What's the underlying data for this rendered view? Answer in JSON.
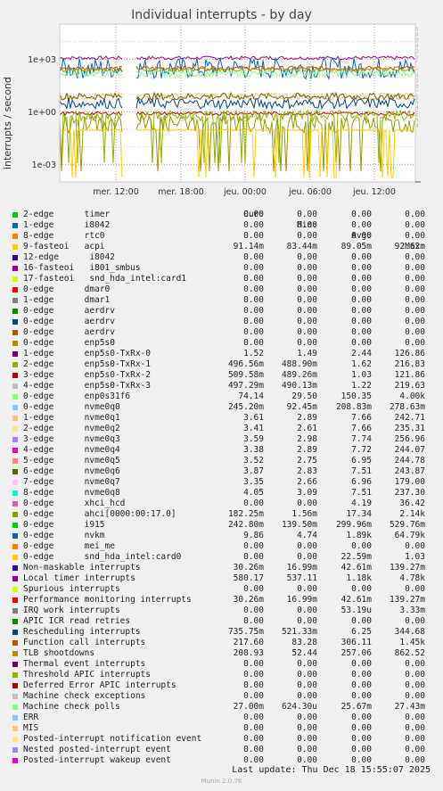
{
  "chart_data": {
    "type": "line",
    "title": "Individual interrupts - by day",
    "ylabel": "interrupts / second",
    "yscale": "log",
    "ylim": [
      0.0001,
      100000
    ],
    "yticks": [
      "1e+03",
      "1e+00",
      "1e-03"
    ],
    "xticks": [
      "mer. 12:00",
      "mer. 18:00",
      "jeu. 00:00",
      "jeu. 06:00",
      "jeu. 12:00"
    ],
    "grid": true,
    "columns": [
      "Cur:",
      "Min:",
      "Avg:",
      "Max:"
    ],
    "series": [
      {
        "name": "2-edge      timer",
        "color": "#00cc00",
        "cur": "0.00",
        "min": "0.00",
        "avg": "0.00",
        "max": "0.00"
      },
      {
        "name": "1-edge      i8042",
        "color": "#0066b3",
        "cur": "0.00",
        "min": "0.00",
        "avg": "0.00",
        "max": "0.00"
      },
      {
        "name": "8-edge      rtc0",
        "color": "#ff8000",
        "cur": "0.00",
        "min": "0.00",
        "avg": "0.00",
        "max": "0.00"
      },
      {
        "name": "9-fasteoi   acpi",
        "color": "#ffcc00",
        "cur": "91.14m",
        "min": "83.44m",
        "avg": "89.05m",
        "max": "92.62m"
      },
      {
        "name": "12-edge      i8042",
        "color": "#330099",
        "cur": "0.00",
        "min": "0.00",
        "avg": "0.00",
        "max": "0.00"
      },
      {
        "name": "16-fasteoi   i801_smbus",
        "color": "#990099",
        "cur": "0.00",
        "min": "0.00",
        "avg": "0.00",
        "max": "0.00"
      },
      {
        "name": "17-fasteoi   snd_hda_intel:card1",
        "color": "#ccff00",
        "cur": "0.00",
        "min": "0.00",
        "avg": "0.00",
        "max": "0.00"
      },
      {
        "name": "0-edge      dmar0",
        "color": "#ff0000",
        "cur": "0.00",
        "min": "0.00",
        "avg": "0.00",
        "max": "0.00"
      },
      {
        "name": "1-edge      dmar1",
        "color": "#808080",
        "cur": "0.00",
        "min": "0.00",
        "avg": "0.00",
        "max": "0.00"
      },
      {
        "name": "0-edge      aerdrv",
        "color": "#008f00",
        "cur": "0.00",
        "min": "0.00",
        "avg": "0.00",
        "max": "0.00"
      },
      {
        "name": "0-edge      aerdrv",
        "color": "#00487d",
        "cur": "0.00",
        "min": "0.00",
        "avg": "0.00",
        "max": "0.00"
      },
      {
        "name": "0-edge      aerdrv",
        "color": "#b35a00",
        "cur": "0.00",
        "min": "0.00",
        "avg": "0.00",
        "max": "0.00"
      },
      {
        "name": "0-edge      enp5s0",
        "color": "#b38f00",
        "cur": "0.00",
        "min": "0.00",
        "avg": "0.00",
        "max": "0.00"
      },
      {
        "name": "1-edge      enp5s0-TxRx-0",
        "color": "#6b006b",
        "cur": "1.52",
        "min": "1.49",
        "avg": "2.44",
        "max": "126.86"
      },
      {
        "name": "2-edge      enp5s0-TxRx-1",
        "color": "#8fb300",
        "cur": "496.56m",
        "min": "488.90m",
        "avg": "1.62",
        "max": "216.83"
      },
      {
        "name": "3-edge      enp5s0-TxRx-2",
        "color": "#b30000",
        "cur": "509.58m",
        "min": "489.26m",
        "avg": "1.03",
        "max": "121.86"
      },
      {
        "name": "4-edge      enp5s0-TxRx-3",
        "color": "#bebebe",
        "cur": "497.29m",
        "min": "490.13m",
        "avg": "1.22",
        "max": "219.63"
      },
      {
        "name": "0-edge      enp0s31f6",
        "color": "#80ff80",
        "cur": "74.14",
        "min": "29.50",
        "avg": "150.35",
        "max": "4.00k"
      },
      {
        "name": "0-edge      nvme0q0",
        "color": "#80c9ff",
        "cur": "245.20m",
        "min": "92.45m",
        "avg": "208.83m",
        "max": "278.63m"
      },
      {
        "name": "1-edge      nvme0q1",
        "color": "#ffc080",
        "cur": "3.61",
        "min": "2.89",
        "avg": "7.66",
        "max": "242.71"
      },
      {
        "name": "2-edge      nvme0q2",
        "color": "#ffe680",
        "cur": "3.41",
        "min": "2.61",
        "avg": "7.66",
        "max": "235.31"
      },
      {
        "name": "3-edge      nvme0q3",
        "color": "#aa80ff",
        "cur": "3.59",
        "min": "2.98",
        "avg": "7.74",
        "max": "256.96"
      },
      {
        "name": "4-edge      nvme0q4",
        "color": "#ee00cc",
        "cur": "3.38",
        "min": "2.89",
        "avg": "7.72",
        "max": "244.07"
      },
      {
        "name": "5-edge      nvme0q5",
        "color": "#ff8080",
        "cur": "3.52",
        "min": "2.75",
        "avg": "6.95",
        "max": "244.78"
      },
      {
        "name": "6-edge      nvme0q6",
        "color": "#666600",
        "cur": "3.87",
        "min": "2.83",
        "avg": "7.51",
        "max": "243.87"
      },
      {
        "name": "7-edge      nvme0q7",
        "color": "#ffbfff",
        "cur": "3.35",
        "min": "2.66",
        "avg": "6.96",
        "max": "179.00"
      },
      {
        "name": "8-edge      nvme0q8",
        "color": "#00ffcc",
        "cur": "4.05",
        "min": "3.09",
        "avg": "7.51",
        "max": "237.30"
      },
      {
        "name": "0-edge      xhci_hcd",
        "color": "#cc6699",
        "cur": "0.00",
        "min": "0.00",
        "avg": "4.19",
        "max": "36.42"
      },
      {
        "name": "0-edge      ahci[0000:00:17.0]",
        "color": "#999900",
        "cur": "182.25m",
        "min": "1.56m",
        "avg": "17.34",
        "max": "2.14k"
      },
      {
        "name": "0-edge      i915",
        "color": "#00cc00",
        "cur": "242.80m",
        "min": "139.50m",
        "avg": "299.96m",
        "max": "529.76m"
      },
      {
        "name": "0-edge      nvkm",
        "color": "#0066b3",
        "cur": "9.86",
        "min": "4.74",
        "avg": "1.89k",
        "max": "64.79k"
      },
      {
        "name": "0-edge      mei_me",
        "color": "#ff8000",
        "cur": "0.00",
        "min": "0.00",
        "avg": "0.00",
        "max": "0.00"
      },
      {
        "name": "0-edge      snd_hda_intel:card0",
        "color": "#ffcc00",
        "cur": "0.00",
        "min": "0.00",
        "avg": "22.59m",
        "max": "1.03"
      },
      {
        "name": "Non-maskable interrupts",
        "color": "#330099",
        "cur": "30.26m",
        "min": "16.99m",
        "avg": "42.61m",
        "max": "139.27m"
      },
      {
        "name": "Local timer interrupts",
        "color": "#990099",
        "cur": "580.17",
        "min": "537.11",
        "avg": "1.18k",
        "max": "4.78k"
      },
      {
        "name": "Spurious interrupts",
        "color": "#ccff00",
        "cur": "0.00",
        "min": "0.00",
        "avg": "0.00",
        "max": "0.00"
      },
      {
        "name": "Performance monitoring interrupts",
        "color": "#ff0000",
        "cur": "30.26m",
        "min": "16.99m",
        "avg": "42.61m",
        "max": "139.27m"
      },
      {
        "name": "IRQ work interrupts",
        "color": "#808080",
        "cur": "0.00",
        "min": "0.00",
        "avg": "53.19u",
        "max": "3.33m"
      },
      {
        "name": "APIC ICR read retries",
        "color": "#008f00",
        "cur": "0.00",
        "min": "0.00",
        "avg": "0.00",
        "max": "0.00"
      },
      {
        "name": "Rescheduling interrupts",
        "color": "#00487d",
        "cur": "735.75m",
        "min": "521.33m",
        "avg": "6.25",
        "max": "344.68"
      },
      {
        "name": "Function call interrupts",
        "color": "#b35a00",
        "cur": "217.60",
        "min": "83.28",
        "avg": "306.11",
        "max": "1.45k"
      },
      {
        "name": "TLB shootdowns",
        "color": "#b38f00",
        "cur": "208.93",
        "min": "52.44",
        "avg": "257.06",
        "max": "862.52"
      },
      {
        "name": "Thermal event interrupts",
        "color": "#6b006b",
        "cur": "0.00",
        "min": "0.00",
        "avg": "0.00",
        "max": "0.00"
      },
      {
        "name": "Threshold APIC interrupts",
        "color": "#8fb300",
        "cur": "0.00",
        "min": "0.00",
        "avg": "0.00",
        "max": "0.00"
      },
      {
        "name": "Deferred Error APIC interrupts",
        "color": "#b30000",
        "cur": "0.00",
        "min": "0.00",
        "avg": "0.00",
        "max": "0.00"
      },
      {
        "name": "Machine check exceptions",
        "color": "#bebebe",
        "cur": "0.00",
        "min": "0.00",
        "avg": "0.00",
        "max": "0.00"
      },
      {
        "name": "Machine check polls",
        "color": "#80ff80",
        "cur": "27.00m",
        "min": "624.30u",
        "avg": "25.67m",
        "max": "27.43m"
      },
      {
        "name": "ERR",
        "color": "#80c9ff",
        "cur": "0.00",
        "min": "0.00",
        "avg": "0.00",
        "max": "0.00"
      },
      {
        "name": "MIS",
        "color": "#ffc080",
        "cur": "0.00",
        "min": "0.00",
        "avg": "0.00",
        "max": "0.00"
      },
      {
        "name": "Posted-interrupt notification event",
        "color": "#ffe680",
        "cur": "0.00",
        "min": "0.00",
        "avg": "0.00",
        "max": "0.00"
      },
      {
        "name": "Nested posted-interrupt event",
        "color": "#aa80ff",
        "cur": "0.00",
        "min": "0.00",
        "avg": "0.00",
        "max": "0.00"
      },
      {
        "name": "Posted-interrupt wakeup event",
        "color": "#ee00cc",
        "cur": "0.00",
        "min": "0.00",
        "avg": "0.00",
        "max": "0.00"
      }
    ]
  },
  "side_label": "RRDTOOL / TOBI OETIKER",
  "last_update": "Last update:  Thu Dec 18 15:55:07 2025",
  "footer": "Munin 2.0.76"
}
